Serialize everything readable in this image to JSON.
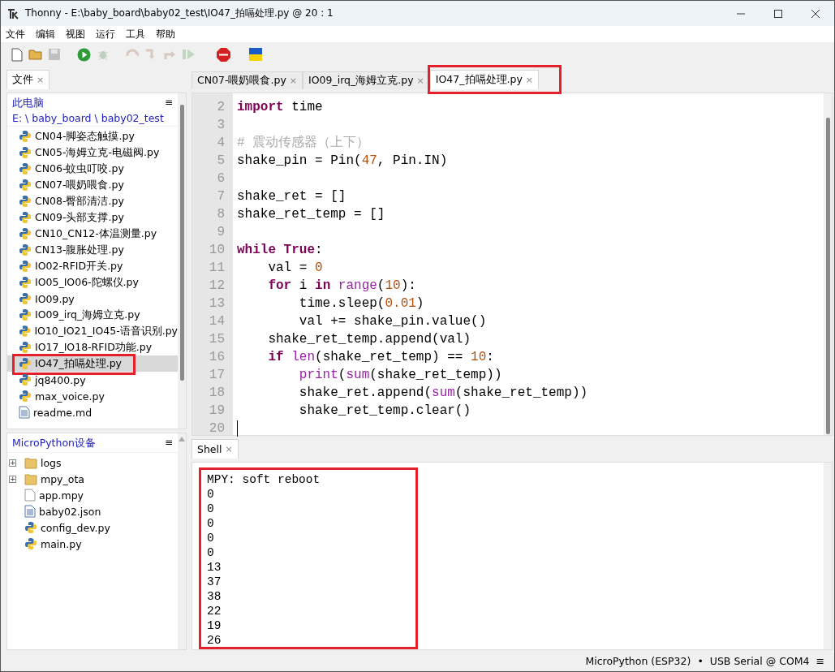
{
  "window": {
    "title": "Thonny  -  E:\\baby_board\\baby02_test\\IO47_拍嗝处理.py  @  20 : 1"
  },
  "menu": [
    "文件",
    "编辑",
    "视图",
    "运行",
    "工具",
    "帮助"
  ],
  "toolbar": [
    {
      "kind": "new",
      "disabled": false
    },
    {
      "kind": "open",
      "disabled": false
    },
    {
      "kind": "save",
      "disabled": true
    },
    {
      "kind": "run",
      "disabled": false
    },
    {
      "kind": "debug",
      "disabled": true
    },
    {
      "kind": "step_over",
      "disabled": true
    },
    {
      "kind": "step_into",
      "disabled": true
    },
    {
      "kind": "step_out",
      "disabled": true
    },
    {
      "kind": "resume",
      "disabled": true
    },
    {
      "kind": "stop",
      "disabled": false
    },
    {
      "kind": "flag",
      "disabled": false
    }
  ],
  "files_panel": {
    "tab": {
      "label": "文件",
      "close": "×"
    },
    "location_label": "此电脑",
    "path": "E: \\ baby_board \\ baby02_test",
    "menu": "≡",
    "items": [
      {
        "name": "CN04-脚姿态触摸.py",
        "kind": "python",
        "selected": false,
        "highlighted": false
      },
      {
        "name": "CN05-海姆立克-电磁阀.py",
        "kind": "python",
        "selected": false,
        "highlighted": false
      },
      {
        "name": "CN06-蚊虫叮咬.py",
        "kind": "python",
        "selected": false,
        "highlighted": false
      },
      {
        "name": "CN07-喂奶喂食.py",
        "kind": "python",
        "selected": false,
        "highlighted": false
      },
      {
        "name": "CN08-臀部清洁.py",
        "kind": "python",
        "selected": false,
        "highlighted": false
      },
      {
        "name": "CN09-头部支撑.py",
        "kind": "python",
        "selected": false,
        "highlighted": false
      },
      {
        "name": "CN10_CN12-体温测量.py",
        "kind": "python",
        "selected": false,
        "highlighted": false
      },
      {
        "name": "CN13-腹胀处理.py",
        "kind": "python",
        "selected": false,
        "highlighted": false
      },
      {
        "name": "IO02-RFID开关.py",
        "kind": "python",
        "selected": false,
        "highlighted": false
      },
      {
        "name": "IO05_IO06-陀螺仪.py",
        "kind": "python",
        "selected": false,
        "highlighted": false
      },
      {
        "name": "IO09.py",
        "kind": "python",
        "selected": false,
        "highlighted": false
      },
      {
        "name": "IO09_irq_海姆立克.py",
        "kind": "python",
        "selected": false,
        "highlighted": false
      },
      {
        "name": "IO10_IO21_IO45-语音识别.py",
        "kind": "python",
        "selected": false,
        "highlighted": false
      },
      {
        "name": "IO17_IO18-RFID功能.py",
        "kind": "python",
        "selected": false,
        "highlighted": false
      },
      {
        "name": "IO47_拍嗝处理.py",
        "kind": "python",
        "selected": true,
        "highlighted": true
      },
      {
        "name": "jq8400.py",
        "kind": "python",
        "selected": false,
        "highlighted": false
      },
      {
        "name": "max_voice.py",
        "kind": "python",
        "selected": false,
        "highlighted": false
      },
      {
        "name": "readme.md",
        "kind": "text",
        "selected": false,
        "highlighted": false
      }
    ]
  },
  "device_panel": {
    "title": "MicroPython设备",
    "menu": "≡",
    "items": [
      {
        "name": "logs",
        "kind": "folder",
        "expander": "+"
      },
      {
        "name": "mpy_ota",
        "kind": "folder",
        "expander": "+"
      },
      {
        "name": "app.mpy",
        "kind": "blank"
      },
      {
        "name": "baby02.json",
        "kind": "text"
      },
      {
        "name": "config_dev.py",
        "kind": "python"
      },
      {
        "name": "main.py",
        "kind": "python"
      }
    ]
  },
  "editor_tabs": [
    {
      "label": "CN07-喂奶喂食.py",
      "close": "×",
      "selected": false,
      "highlighted": false
    },
    {
      "label": "IO09_irq_海姆立克.py",
      "close": "×",
      "selected": false,
      "highlighted": false
    },
    {
      "label": "IO47_拍嗝处理.py",
      "close": "×",
      "selected": true,
      "highlighted": true
    }
  ],
  "editor": {
    "lines": [
      {
        "number": "2",
        "tokens": [
          {
            "kind": "keyword",
            "text": "import"
          },
          {
            "kind": "plain",
            "text": " time"
          }
        ]
      },
      {
        "number": "3"
      },
      {
        "number": "4",
        "tokens": [
          {
            "kind": "comment",
            "text": "# 震动传感器（上下）"
          }
        ]
      },
      {
        "number": "5",
        "tokens": [
          {
            "kind": "plain",
            "text": "shake_pin = Pin("
          },
          {
            "kind": "number",
            "text": "47"
          },
          {
            "kind": "plain",
            "text": ", Pin.IN)"
          }
        ]
      },
      {
        "number": "6"
      },
      {
        "number": "7",
        "tokens": [
          {
            "kind": "plain",
            "text": "shake_ret = []"
          }
        ]
      },
      {
        "number": "8",
        "tokens": [
          {
            "kind": "plain",
            "text": "shake_ret_temp = []"
          }
        ]
      },
      {
        "number": "9"
      },
      {
        "number": "10",
        "tokens": [
          {
            "kind": "keyword",
            "text": "while True"
          },
          {
            "kind": "plain",
            "text": ":"
          }
        ]
      },
      {
        "number": "11",
        "tokens": [
          {
            "kind": "plain",
            "text": "    val = "
          },
          {
            "kind": "number",
            "text": "0"
          }
        ]
      },
      {
        "number": "12",
        "tokens": [
          {
            "kind": "keyword",
            "text": "    for"
          },
          {
            "kind": "plain",
            "text": " i "
          },
          {
            "kind": "keyword",
            "text": "in "
          },
          {
            "kind": "builtin",
            "text": "range"
          },
          {
            "kind": "plain",
            "text": "("
          },
          {
            "kind": "number",
            "text": "10"
          },
          {
            "kind": "plain",
            "text": "):"
          }
        ]
      },
      {
        "number": "13",
        "tokens": [
          {
            "kind": "plain",
            "text": "        time.sleep("
          },
          {
            "kind": "number",
            "text": "0.01"
          },
          {
            "kind": "plain",
            "text": ")"
          }
        ]
      },
      {
        "number": "14",
        "tokens": [
          {
            "kind": "plain",
            "text": "        val += shake_pin.value()"
          }
        ]
      },
      {
        "number": "15",
        "tokens": [
          {
            "kind": "plain",
            "text": "    shake_ret_temp.append(val)"
          }
        ]
      },
      {
        "number": "16",
        "tokens": [
          {
            "kind": "keyword",
            "text": "    if "
          },
          {
            "kind": "builtin",
            "text": "len"
          },
          {
            "kind": "plain",
            "text": "(shake_ret_temp) == "
          },
          {
            "kind": "number",
            "text": "10"
          },
          {
            "kind": "plain",
            "text": ":"
          }
        ]
      },
      {
        "number": "17",
        "tokens": [
          {
            "kind": "builtin",
            "text": "        print"
          },
          {
            "kind": "plain",
            "text": "("
          },
          {
            "kind": "builtin",
            "text": "sum"
          },
          {
            "kind": "plain",
            "text": "(shake_ret_temp))"
          }
        ]
      },
      {
        "number": "18",
        "tokens": [
          {
            "kind": "plain",
            "text": "        shake_ret.append("
          },
          {
            "kind": "builtin",
            "text": "sum"
          },
          {
            "kind": "plain",
            "text": "(shake_ret_temp))"
          }
        ]
      },
      {
        "number": "19",
        "tokens": [
          {
            "kind": "plain",
            "text": "        shake_ret_temp.clear()"
          }
        ]
      },
      {
        "number": "20",
        "cursor": true
      }
    ]
  },
  "shell": {
    "tab": {
      "label": "Shell",
      "close": "×"
    },
    "highlighted": true,
    "lines": [
      "MPY: soft reboot",
      "0",
      "0",
      "0",
      "0",
      "0",
      "13",
      "37",
      "38",
      "22",
      "19",
      "26"
    ]
  },
  "status_bar": {
    "interpreter": "MicroPython (ESP32)",
    "separator": "•",
    "port": "USB Serial @ COM4",
    "menu": "≡"
  }
}
